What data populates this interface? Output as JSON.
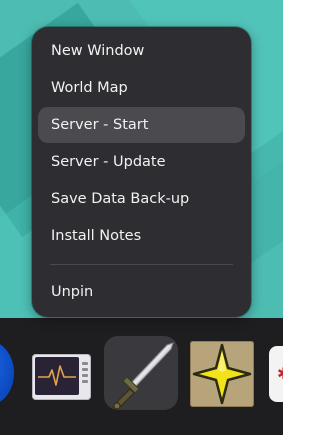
{
  "context_menu": {
    "items": [
      {
        "label": "New Window"
      },
      {
        "label": "World Map"
      },
      {
        "label": "Server - Start"
      },
      {
        "label": "Server - Update"
      },
      {
        "label": "Save Data Back-up"
      },
      {
        "label": "Install Notes"
      },
      {
        "label": "Unpin"
      }
    ],
    "hovered_item": "Server - Start"
  },
  "dock": {
    "apps": [
      {
        "icon": "firefox-icon",
        "active": false
      },
      {
        "icon": "system-monitor-icon",
        "active": false
      },
      {
        "icon": "sword-game-icon",
        "active": true
      },
      {
        "icon": "yellow-star-icon",
        "active": false
      },
      {
        "icon": "app-icon-partial",
        "active": false
      }
    ]
  },
  "colors": {
    "desktop_background": "#4dbdb2",
    "menu_background": "#2e2e32",
    "menu_hover": "#4a4a4f",
    "dock_background": "#1e1e20",
    "menu_text": "#f2f2f2",
    "star_yellow": "#f2e21a"
  }
}
